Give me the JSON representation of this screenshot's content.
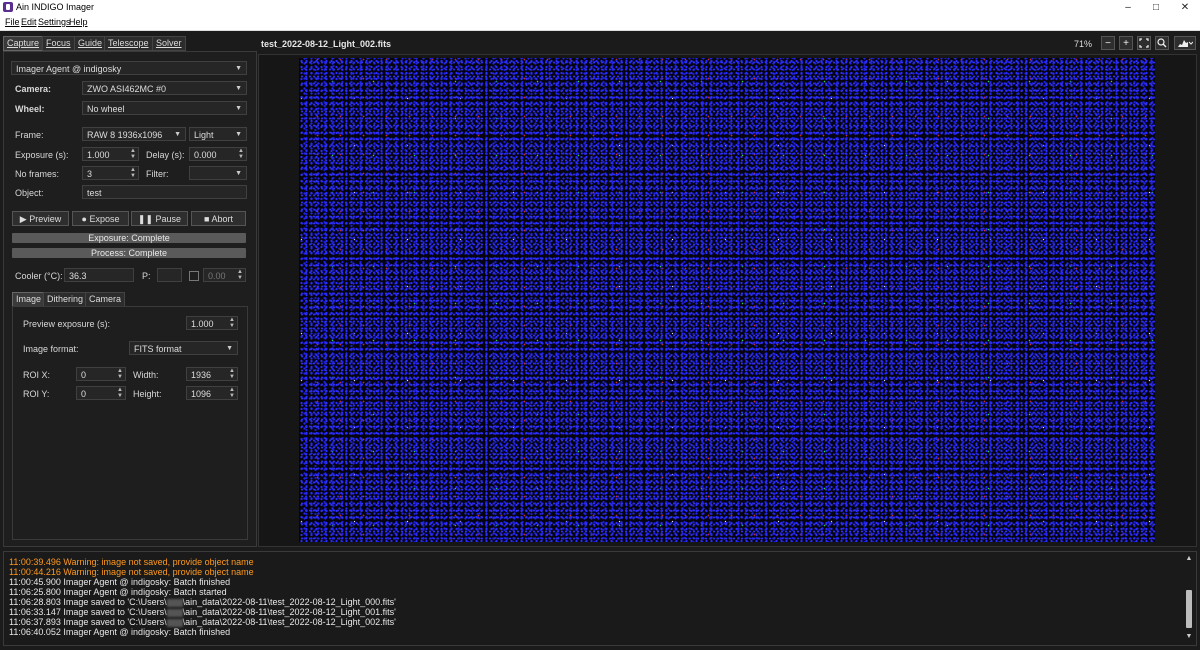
{
  "window": {
    "title": "Ain INDIGO Imager",
    "minimize": "–",
    "maximize": "□",
    "close": "✕"
  },
  "menu": [
    "File",
    "Edit",
    "Settings",
    "Help"
  ],
  "tabs": [
    "Capture",
    "Focus",
    "Guide",
    "Telescope",
    "Solver"
  ],
  "capture": {
    "agent": "Imager Agent @ indigosky",
    "camera_label": "Camera:",
    "camera_value": "ZWO ASI462MC #0",
    "wheel_label": "Wheel:",
    "wheel_value": "No wheel",
    "frame_label": "Frame:",
    "frame_value": "RAW 8 1936x1096",
    "frame_type": "Light",
    "exposure_label": "Exposure (s):",
    "exposure_value": "1.000",
    "delay_label": "Delay (s):",
    "delay_value": "0.000",
    "frames_label": "No frames:",
    "frames_value": "3",
    "filter_label": "Filter:",
    "filter_value": "",
    "object_label": "Object:",
    "object_value": "test",
    "preview_btn": "Preview",
    "expose_btn": "Expose",
    "pause_btn": "Pause",
    "abort_btn": "Abort",
    "exposure_status": "Exposure: Complete",
    "process_status": "Process: Complete",
    "exposure_progress": 1.0,
    "process_progress": 1.0,
    "cooler_label": "Cooler (°C):",
    "cooler_value": "36.3",
    "power_label": "P:",
    "power_value": "",
    "cooler_setpoint": "0.00"
  },
  "subtabs": [
    "Image",
    "Dithering",
    "Camera"
  ],
  "image_settings": {
    "preview_exposure_label": "Preview exposure (s):",
    "preview_exposure_value": "1.000",
    "format_label": "Image format:",
    "format_value": "FITS format",
    "roi_x_label": "ROI X:",
    "roi_x_value": "0",
    "width_label": "Width:",
    "width_value": "1936",
    "roi_y_label": "ROI Y:",
    "roi_y_value": "0",
    "height_label": "Height:",
    "height_value": "1096"
  },
  "viewer": {
    "filename": "test_2022-08-12_Light_002.fits",
    "zoom": "71%",
    "zoom_out": "−",
    "zoom_in": "+",
    "fit_icon": "fit-to-window-icon",
    "magnify_icon": "magnifier-icon",
    "histogram_icon": "histogram-icon"
  },
  "log": [
    {
      "text": "11:00:39.496 Warning: image not saved, provide object name",
      "warn": true
    },
    {
      "text": "11:00:44.216 Warning: image not saved, provide object name",
      "warn": true
    },
    {
      "text": "11:00:45.900 Imager Agent @ indigosky: Batch finished",
      "warn": false
    },
    {
      "text": "11:06:25.800 Imager Agent @ indigosky: Batch started",
      "warn": false
    },
    {
      "pre": "11:06:28.803 Image saved to 'C:\\Users\\",
      "post": "\\ain_data\\2022-08-11\\test_2022-08-12_Light_000.fits'",
      "warn": false
    },
    {
      "pre": "11:06:33.147 Image saved to 'C:\\Users\\",
      "post": "\\ain_data\\2022-08-11\\test_2022-08-12_Light_001.fits'",
      "warn": false
    },
    {
      "pre": "11:06:37.893 Image saved to 'C:\\Users\\",
      "post": "\\ain_data\\2022-08-11\\test_2022-08-12_Light_002.fits'",
      "warn": false
    },
    {
      "text": "11:06:40.052 Imager Agent @ indigosky: Batch finished",
      "warn": false
    }
  ]
}
